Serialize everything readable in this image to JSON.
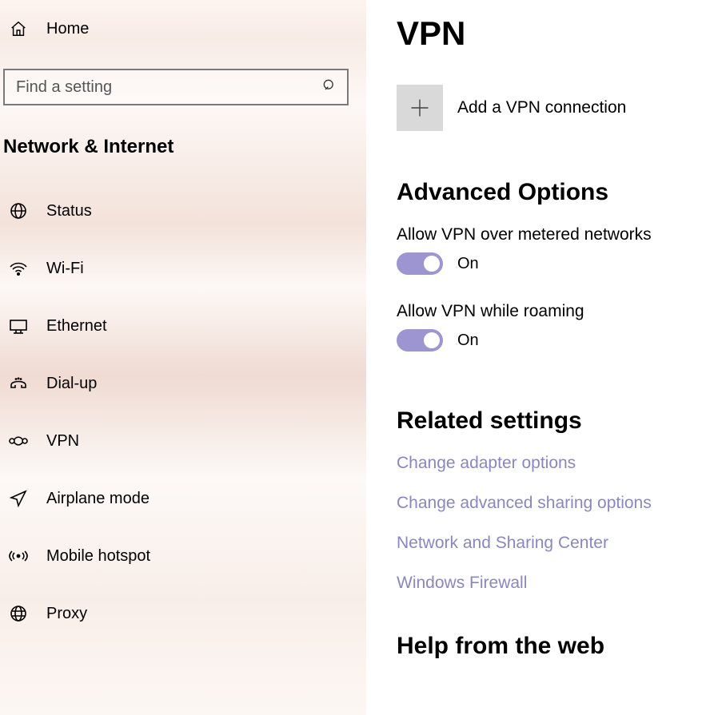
{
  "sidebar": {
    "home": "Home",
    "search_placeholder": "Find a setting",
    "category": "Network & Internet",
    "items": [
      {
        "label": "Status"
      },
      {
        "label": "Wi-Fi"
      },
      {
        "label": "Ethernet"
      },
      {
        "label": "Dial-up"
      },
      {
        "label": "VPN"
      },
      {
        "label": "Airplane mode"
      },
      {
        "label": "Mobile hotspot"
      },
      {
        "label": "Proxy"
      }
    ]
  },
  "main": {
    "title": "VPN",
    "add_label": "Add a VPN connection",
    "advanced_heading": "Advanced Options",
    "opt_metered_label": "Allow VPN over metered networks",
    "opt_metered_state": "On",
    "opt_roaming_label": "Allow VPN while roaming",
    "opt_roaming_state": "On",
    "related_heading": "Related settings",
    "links": [
      "Change adapter options",
      "Change advanced sharing options",
      "Network and Sharing Center",
      "Windows Firewall"
    ],
    "help_heading": "Help from the web"
  }
}
